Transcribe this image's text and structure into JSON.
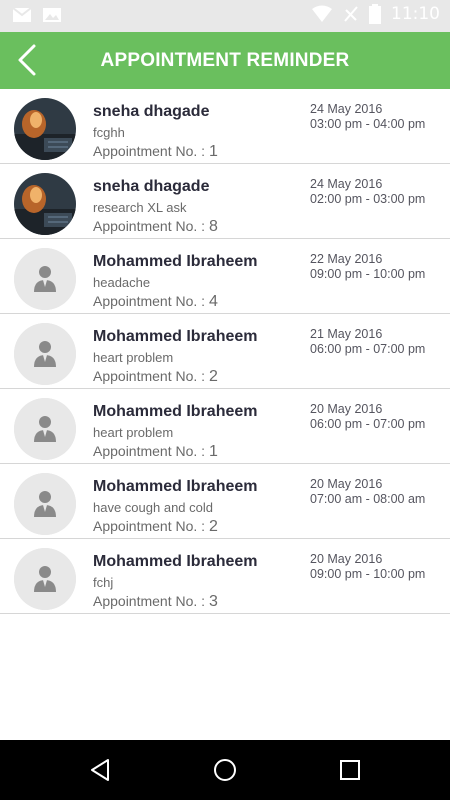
{
  "status_bar": {
    "time": "11:10",
    "icons": [
      "mail-icon",
      "image-icon",
      "wifi-icon",
      "no-signal-icon",
      "battery-icon"
    ]
  },
  "header": {
    "title": "APPOINTMENT REMINDER",
    "back_icon": "chevron-left-icon",
    "color": "#6abf5e"
  },
  "appointments": [
    {
      "name": "sneha dhagade",
      "description": "fcghh",
      "appt_label": "Appointment No. :",
      "appt_no": "1",
      "date": "24 May 2016",
      "time": "03:00 pm - 04:00 pm",
      "avatar": "photo"
    },
    {
      "name": "sneha dhagade",
      "description": "research XL ask",
      "appt_label": "Appointment No. :",
      "appt_no": "8",
      "date": "24 May 2016",
      "time": "02:00 pm - 03:00 pm",
      "avatar": "photo"
    },
    {
      "name": "Mohammed Ibraheem",
      "description": "headache",
      "appt_label": "Appointment No. :",
      "appt_no": "4",
      "date": "22 May 2016",
      "time": "09:00 pm - 10:00 pm",
      "avatar": "placeholder"
    },
    {
      "name": "Mohammed Ibraheem",
      "description": "heart problem",
      "appt_label": "Appointment No. :",
      "appt_no": "2",
      "date": "21 May 2016",
      "time": "06:00 pm - 07:00 pm",
      "avatar": "placeholder"
    },
    {
      "name": "Mohammed Ibraheem",
      "description": "heart problem",
      "appt_label": "Appointment No. :",
      "appt_no": "1",
      "date": "20 May 2016",
      "time": "06:00 pm - 07:00 pm",
      "avatar": "placeholder"
    },
    {
      "name": "Mohammed Ibraheem",
      "description": "have cough and cold",
      "appt_label": "Appointment No. :",
      "appt_no": "2",
      "date": "20 May 2016",
      "time": "07:00 am - 08:00 am",
      "avatar": "placeholder"
    },
    {
      "name": "Mohammed Ibraheem",
      "description": "fchj",
      "appt_label": "Appointment No. :",
      "appt_no": "3",
      "date": "20 May 2016",
      "time": "09:00 pm - 10:00 pm",
      "avatar": "placeholder"
    }
  ],
  "nav_bar": {
    "icons": [
      "back-triangle-icon",
      "home-circle-icon",
      "recents-square-icon"
    ]
  }
}
